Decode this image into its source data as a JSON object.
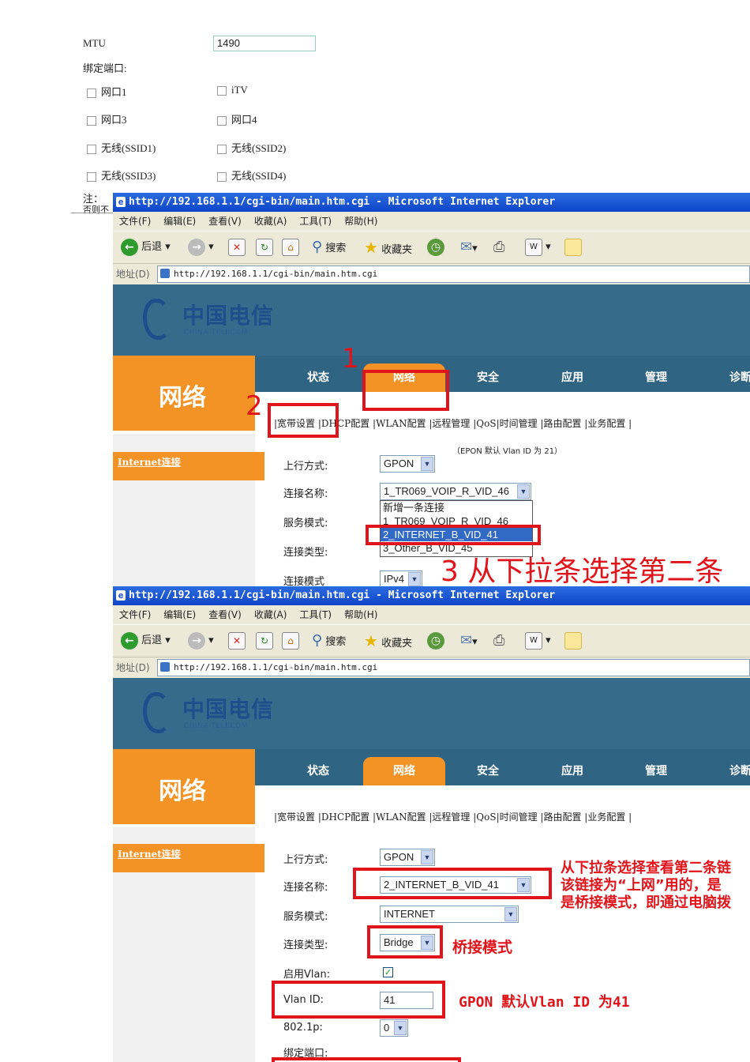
{
  "fragment": {
    "mtu_label": "MTU",
    "mtu_value": "1490",
    "bind_ports_label": "绑定端口:",
    "checkboxes": [
      "网口1",
      "iTV",
      "网口3",
      "网口4",
      "无线(SSID1)",
      "无线(SSID2)",
      "无线(SSID3)",
      "无线(SSID4)"
    ],
    "note_prefix": "注：",
    "note_fragment": "否则不"
  },
  "browser": {
    "title": "http://192.168.1.1/cgi-bin/main.htm.cgi - Microsoft Internet Explorer",
    "menu": [
      "文件(F)",
      "编辑(E)",
      "查看(V)",
      "收藏(A)",
      "工具(T)",
      "帮助(H)"
    ],
    "toolbar": {
      "back": "后退",
      "search": "搜索",
      "favorites": "收藏夹"
    },
    "address_label": "地址(D)",
    "address": "http://192.168.1.1/cgi-bin/main.htm.cgi"
  },
  "router": {
    "logo_cn": "中国电信",
    "logo_en": "CHINA TELECOM",
    "section": "网络",
    "tabs": [
      "状态",
      "网络",
      "安全",
      "应用",
      "管理",
      "诊断"
    ],
    "subnav": "|宽带设置 |DHCP配置 |WLAN配置 |远程管理 |QoS|时间管理 |路由配置 |业务配置 |",
    "left_link": "Internet连接"
  },
  "screen1": {
    "epon_note": "（EPON 默认 Vlan ID 为 21）",
    "uplink_label": "上行方式:",
    "uplink_value": "GPON",
    "conn_name_label": "连接名称:",
    "conn_name_value": "1_TR069_VOIP_R_VID_46",
    "service_label": "服务模式:",
    "conn_type_label": "连接类型:",
    "conn_mode_label": "连接模式",
    "conn_mode_value": "IPv4",
    "dropdown": [
      "新增一条连接",
      "1_TR069_VOIP_R_VID_46",
      "2_INTERNET_B_VID_41",
      "3_Other_B_VID_45"
    ],
    "ann_1": "1",
    "ann_2": "2",
    "ann_3": "3 从下拉条选择第二条"
  },
  "screen2": {
    "uplink_label": "上行方式:",
    "uplink_value": "GPON",
    "conn_name_label": "连接名称:",
    "conn_name_value": "2_INTERNET_B_VID_41",
    "service_label": "服务模式:",
    "service_value": "INTERNET",
    "conn_type_label": "连接类型:",
    "conn_type_value": "Bridge",
    "vlan_enable_label": "启用Vlan:",
    "vlan_id_label": "Vlan ID:",
    "vlan_id_value": "41",
    "p8021_label": "802.1p:",
    "p8021_value": "0",
    "bind_label": "绑定端口:",
    "ann_line1": "从下拉条选择查看第二条链",
    "ann_line2": "该链接为“上网”用的，是",
    "ann_line3": "是桥接模式，即通过电脑拨",
    "ann_bridge": "桥接模式",
    "ann_vlan": "GPON  默认Vlan ID 为41"
  }
}
